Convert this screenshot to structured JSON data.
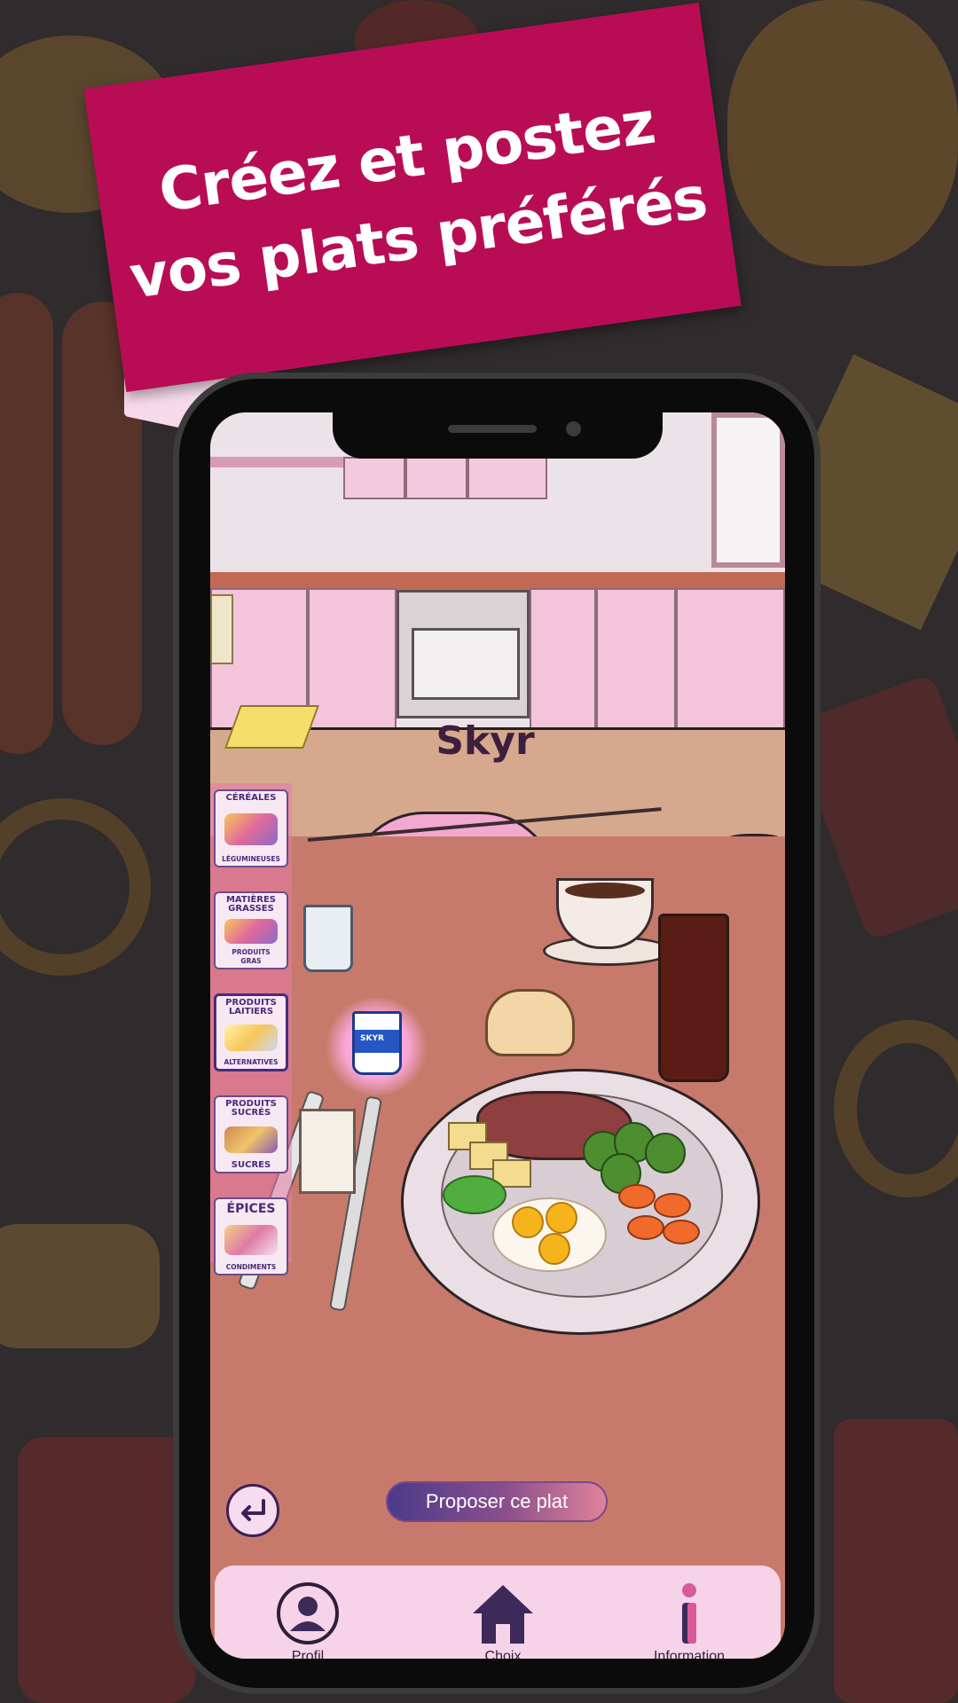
{
  "banner": {
    "line1": "Créez et postez",
    "line2": "vos plats préférés"
  },
  "scene": {
    "selected_food": "Skyr",
    "skyr_cup_label": "SKYR"
  },
  "categories": [
    {
      "top": "CÉRÉALES",
      "bottom": "LÉGUMINEUSES",
      "selected": false
    },
    {
      "top": "MATIÈRES\nGRASSES",
      "bottom": "PRODUITS\nGRAS",
      "selected": false
    },
    {
      "top": "PRODUITS\nLAITIERS",
      "bottom": "ALTERNATIVES",
      "selected": true
    },
    {
      "top": "PRODUITS\nSUCRÉS",
      "bottom": "SUCRES",
      "selected": false
    },
    {
      "top": "ÉPICES",
      "bottom": "CONDIMENTS",
      "selected": false
    }
  ],
  "actions": {
    "propose": "Proposer ce plat",
    "back_icon": "back-arrow-icon"
  },
  "bottom_nav": [
    {
      "label": "Profil",
      "icon": "profile-icon"
    },
    {
      "label": "Choix",
      "icon": "home-icon"
    },
    {
      "label": "Information",
      "icon": "info-icon"
    }
  ],
  "colors": {
    "banner": "#b80d55",
    "accent_purple": "#4a2a7a",
    "table": "#c77a6c",
    "nav_bg": "#f6d3e8"
  }
}
